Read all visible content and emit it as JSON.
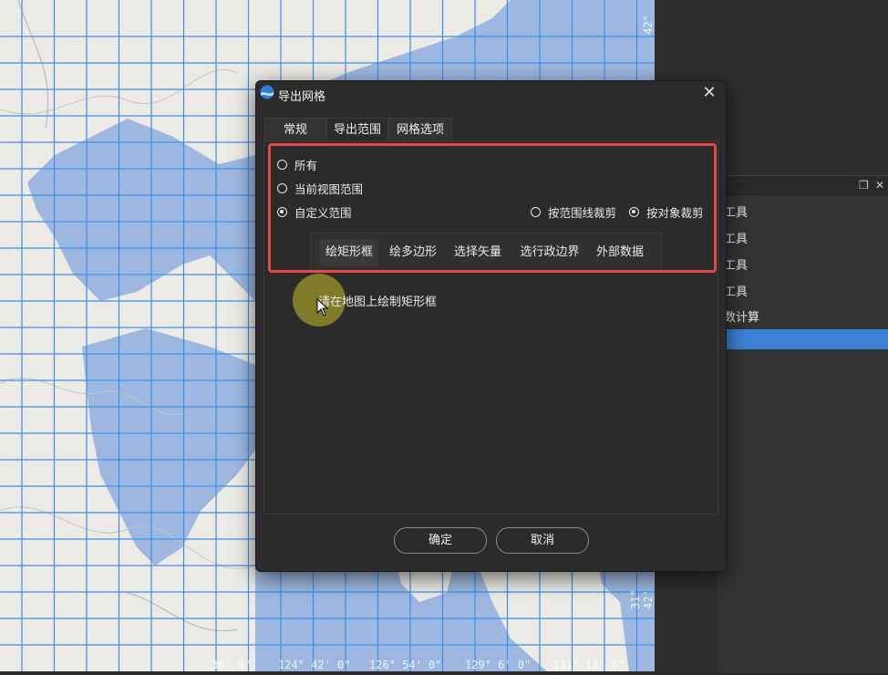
{
  "dialog": {
    "title": "导出网格",
    "tabs": [
      {
        "label": "常规"
      },
      {
        "label": "导出范围"
      },
      {
        "label": "网格选项"
      }
    ],
    "scope_options": [
      {
        "label": "所有",
        "checked": false
      },
      {
        "label": "当前视图范围",
        "checked": false
      },
      {
        "label": "自定义范围",
        "checked": true
      }
    ],
    "clip_options": [
      {
        "label": "按范围线裁剪",
        "checked": false
      },
      {
        "label": "按对象裁剪",
        "checked": true
      }
    ],
    "subtabs": [
      {
        "label": "绘矩形框"
      },
      {
        "label": "绘多边形"
      },
      {
        "label": "选择矢量"
      },
      {
        "label": "选行政边界"
      },
      {
        "label": "外部数据"
      }
    ],
    "hint": "请在地图上绘制矩形框",
    "ok_label": "确定",
    "cancel_label": "取消"
  },
  "sidepanel": {
    "items": [
      {
        "label": "工具"
      },
      {
        "label": "工具"
      },
      {
        "label": "工具"
      },
      {
        "label": "工具"
      },
      {
        "label": "数计算"
      }
    ]
  },
  "map": {
    "coord_labels": [
      {
        "text": "42°"
      },
      {
        "text": "31° 42'"
      },
      {
        "text": "30' 0\""
      },
      {
        "text": "124° 42' 0\""
      },
      {
        "text": "126° 54' 0\""
      },
      {
        "text": "129° 6' 0\""
      },
      {
        "text": "131° 18' 0\""
      }
    ]
  },
  "colors": {
    "accent_red": "#e5484d",
    "selection_blue": "#3b82d6",
    "grid_blue": "#3d8ee8",
    "sea": "#9db7e0",
    "land": "#eceae4"
  }
}
